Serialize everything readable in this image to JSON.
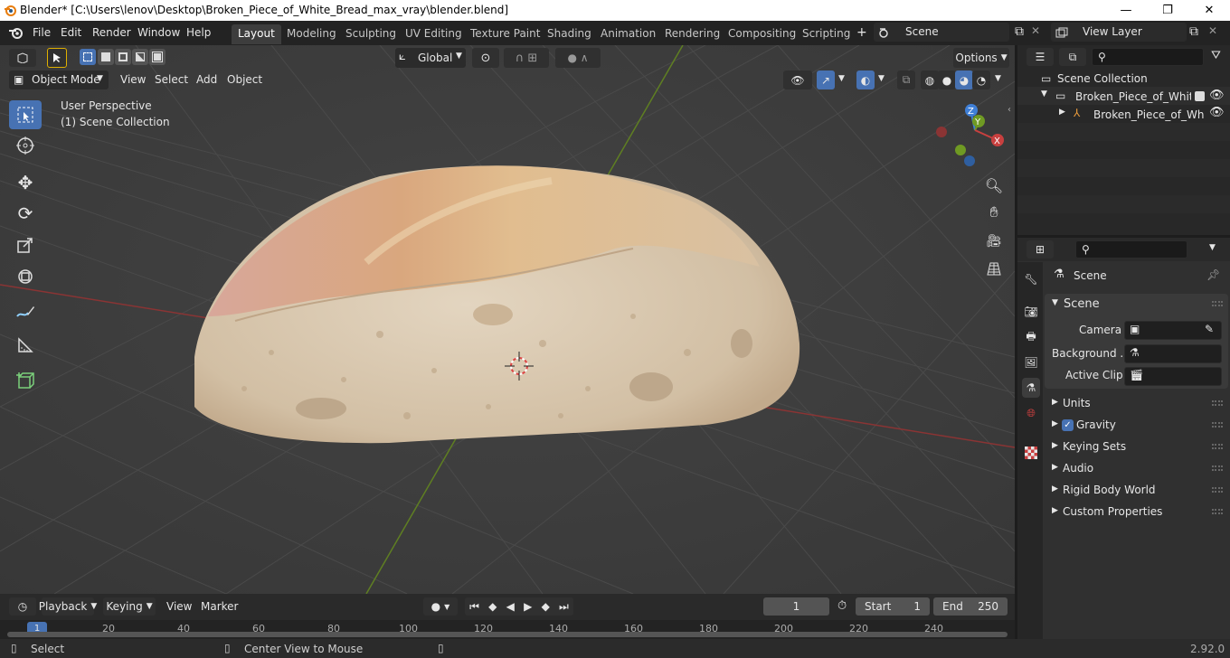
{
  "window": {
    "title": "Blender* [C:\\Users\\lenov\\Desktop\\Broken_Piece_of_White_Bread_max_vray\\blender.blend]",
    "controls": {
      "minimize": "—",
      "maximize": "❐",
      "close": "✕"
    }
  },
  "menu": {
    "file": "File",
    "edit": "Edit",
    "render": "Render",
    "window": "Window",
    "help": "Help"
  },
  "workspaces": [
    "Layout",
    "Modeling",
    "Sculpting",
    "UV Editing",
    "Texture Paint",
    "Shading",
    "Animation",
    "Rendering",
    "Compositing",
    "Scripting"
  ],
  "add_workspace": "+",
  "scene_selector": {
    "value": "Scene"
  },
  "view_layer_selector": {
    "value": "View Layer"
  },
  "viewport_header": {
    "transform_orientation": "Global",
    "options_label": "Options",
    "mode": "Object Mode",
    "menus": {
      "view": "View",
      "select": "Select",
      "add": "Add",
      "object": "Object"
    }
  },
  "viewport": {
    "overlay_title": "User Perspective",
    "overlay_subtitle": "(1) Scene Collection",
    "gizmo_axes": {
      "x": "X",
      "y": "Y",
      "z": "Z"
    }
  },
  "outliner": {
    "root": "Scene Collection",
    "collection": "Broken_Piece_of_White_I",
    "object": "Broken_Piece_of_Wh"
  },
  "properties": {
    "header_title": "Scene",
    "scene_panel": "Scene",
    "camera_label": "Camera",
    "background_label": "Background ...",
    "active_clip_label": "Active Clip",
    "sections": {
      "units": "Units",
      "gravity": "Gravity",
      "keying_sets": "Keying Sets",
      "audio": "Audio",
      "rigid_body_world": "Rigid Body World",
      "custom_properties": "Custom Properties"
    },
    "gravity_enabled": true
  },
  "timeline": {
    "playback": "Playback",
    "keying": "Keying",
    "view": "View",
    "marker": "Marker",
    "current_frame": "1",
    "start_label": "Start",
    "start_value": "1",
    "end_label": "End",
    "end_value": "250",
    "ruler_ticks": [
      "1",
      "20",
      "40",
      "60",
      "80",
      "100",
      "120",
      "140",
      "160",
      "180",
      "200",
      "220",
      "240"
    ]
  },
  "statusbar": {
    "left_action": "Select",
    "middle_action": "Center View to Mouse",
    "version": "2.92.0"
  },
  "colors": {
    "accent_blue": "#4772b3",
    "x_axis": "#c8403f",
    "y_axis": "#6f9a23",
    "z_axis": "#3f7fd6"
  }
}
